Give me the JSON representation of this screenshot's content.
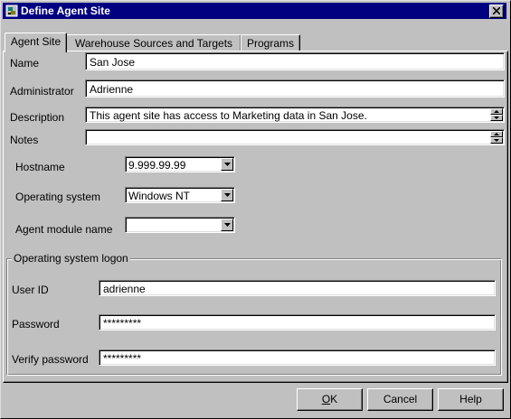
{
  "window": {
    "title": "Define Agent Site",
    "app_icon": "agent-site-icon",
    "close_icon": "close-icon"
  },
  "tabs": [
    {
      "label": "Agent Site",
      "active": true
    },
    {
      "label": "Warehouse Sources and Targets",
      "active": false
    },
    {
      "label": "Programs",
      "active": false
    }
  ],
  "form": {
    "name_label": "Name",
    "name_value": "San Jose",
    "administrator_label": "Administrator",
    "administrator_value": "Adrienne",
    "description_label": "Description",
    "description_value": "This agent site has access to Marketing data in San Jose.",
    "notes_label": "Notes",
    "notes_value": "",
    "hostname_label": "Hostname",
    "hostname_value": "9.999.99.99",
    "os_label": "Operating system",
    "os_value": "Windows NT",
    "agent_module_label": "Agent module name",
    "agent_module_value": ""
  },
  "logon": {
    "group_title": "Operating system logon",
    "userid_label": "User ID",
    "userid_value": "adrienne",
    "password_label": "Password",
    "password_value": "*********",
    "verify_label": "Verify password",
    "verify_value": "*********"
  },
  "buttons": {
    "ok_label_mnemonic": "O",
    "ok_label_rest": "K",
    "cancel_label": "Cancel",
    "help_label": "Help"
  }
}
